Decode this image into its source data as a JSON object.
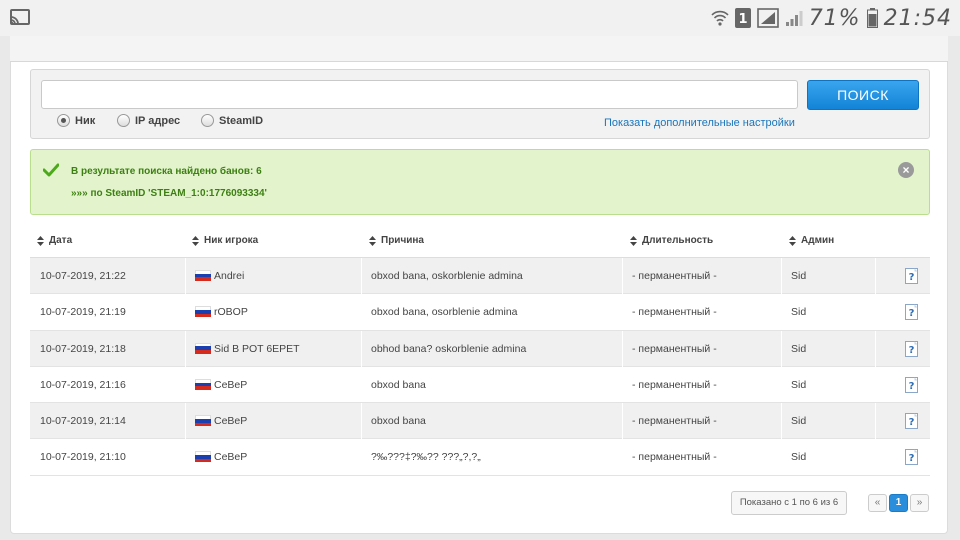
{
  "statusbar": {
    "battery_percent": "71%",
    "clock": "21:54",
    "sim_label": "1"
  },
  "search": {
    "input_value": "",
    "button_label": "ПОИСК",
    "options": [
      {
        "label": "Ник",
        "checked": true
      },
      {
        "label": "IP адрес",
        "checked": false
      },
      {
        "label": "SteamID",
        "checked": false
      }
    ],
    "more_settings_link": "Показать дополнительные настройки"
  },
  "alert": {
    "line1": "В результате поиска найдено банов: 6",
    "line2": "»»» по SteamID 'STEAM_1:0:1776093334'",
    "close_symbol": "×"
  },
  "table": {
    "headers": [
      "Дата",
      "Ник игрока",
      "Причина",
      "Длительность",
      "Админ"
    ],
    "rows": [
      {
        "date": "10-07-2019, 21:22",
        "nick": "Andrei",
        "reason": "obxod bana, oskorblenie admina",
        "duration": "- перманентный -",
        "admin": "Sid"
      },
      {
        "date": "10-07-2019, 21:19",
        "nick": "rOBOP",
        "reason": "obxod bana, osorblenie admina",
        "duration": "- перманентный -",
        "admin": "Sid"
      },
      {
        "date": "10-07-2019, 21:18",
        "nick": "Sid B POT 6EPET",
        "reason": "obhod bana? oskorblenie admina",
        "duration": "- перманентный -",
        "admin": "Sid"
      },
      {
        "date": "10-07-2019, 21:16",
        "nick": "CeBeP",
        "reason": "obxod bana",
        "duration": "- перманентный -",
        "admin": "Sid"
      },
      {
        "date": "10-07-2019, 21:14",
        "nick": "CeBeP",
        "reason": "obxod bana",
        "duration": "- перманентный -",
        "admin": "Sid"
      },
      {
        "date": "10-07-2019, 21:10",
        "nick": "CeBeP",
        "reason": "?‰???‡?‰?? ???„?,?„",
        "duration": "- перманентный -",
        "admin": "Sid"
      }
    ]
  },
  "pagination": {
    "info": "Показано с 1 по 6 из 6",
    "prev": "«",
    "current": "1",
    "next": "»"
  },
  "colors": {
    "accent_blue": "#1283d6",
    "success_bg": "#e3f4cd",
    "success_text": "#3d7f12"
  }
}
